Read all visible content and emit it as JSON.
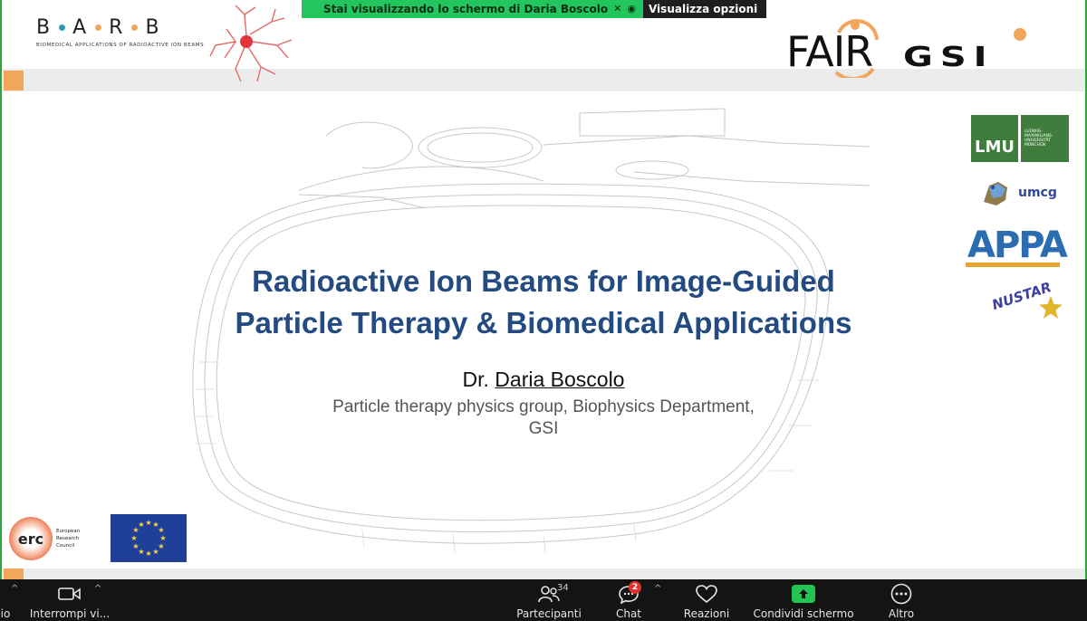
{
  "banner": {
    "message": "Stai visualizzando lo schermo di  Daria Boscolo",
    "options_label": "Visualizza opzioni"
  },
  "slide": {
    "barb": {
      "letters": [
        "B",
        "A",
        "R",
        "B"
      ],
      "subtitle": "BIOMEDICAL APPLICATIONS OF RADIOACTIVE ION BEAMS",
      "dot_colors": [
        "#2a9bb0",
        "#f2a65a",
        "#f2a65a"
      ]
    },
    "fair_label": "FAIR",
    "gsi_label": "GSI",
    "lmu": {
      "short": "LMU",
      "long_lines": [
        "LUDWIG-",
        "MAXIMILIANS-",
        "UNIVERSITÄT",
        "MÜNCHEN"
      ]
    },
    "umcg_label": "umcg",
    "appa_label": "APPA",
    "nustar_label": "NUSTAR",
    "erc": {
      "mark": "erc",
      "lines": [
        "European",
        "Research",
        "Council"
      ]
    },
    "title_lines": [
      "Radioactive Ion Beams for Image-Guided",
      "Particle Therapy & Biomedical Applications"
    ],
    "speaker": {
      "prefix": "Dr.",
      "name": "Daria Boscolo"
    },
    "affiliation_lines": [
      "Particle therapy physics group, Biophysics Department,",
      "GSI"
    ],
    "accent_color": "#f2a65a",
    "title_color": "#234b82"
  },
  "toolbar": {
    "audio_label": "io",
    "video_label": "Interrompi vi...",
    "participants_label": "Partecipanti",
    "participants_count": "34",
    "chat_label": "Chat",
    "chat_badge": "2",
    "reactions_label": "Reazioni",
    "share_label": "Condividi schermo",
    "more_label": "Altro",
    "share_color": "#23c552"
  }
}
